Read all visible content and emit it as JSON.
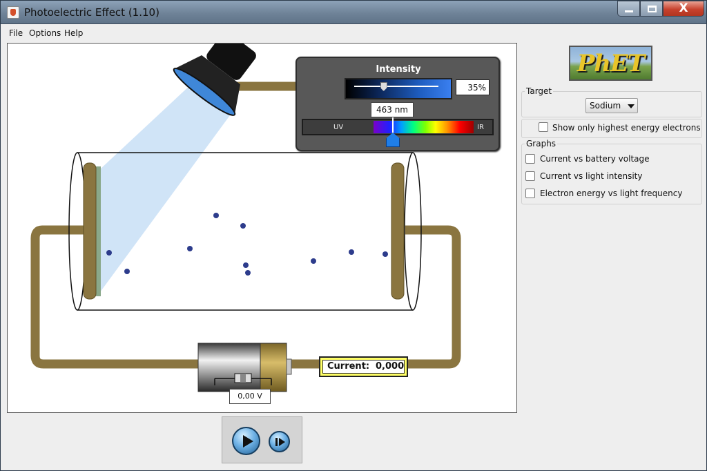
{
  "window": {
    "title": "Photoelectric Effect (1.10)",
    "close_glyph": "X"
  },
  "menu": {
    "items": [
      "File",
      "Options",
      "Help"
    ]
  },
  "intensity": {
    "label": "Intensity",
    "value_text": "35%",
    "value_fraction": 0.35
  },
  "wavelength": {
    "value_text": "463 nm",
    "uv_label": "UV",
    "ir_label": "IR"
  },
  "circuit": {
    "current_label": "Current:",
    "current_value": "0,000",
    "voltage_value": "0,00 V"
  },
  "right_panel": {
    "logo_text": "PhET",
    "target": {
      "label": "Target",
      "selected": "Sodium"
    },
    "highest_energy": {
      "label": "Show only highest energy electrons",
      "checked": false
    },
    "graphs": {
      "label": "Graphs",
      "items": [
        {
          "label": "Current vs battery voltage",
          "checked": false
        },
        {
          "label": "Current vs light intensity",
          "checked": false
        },
        {
          "label": "Electron energy vs light frequency",
          "checked": false
        }
      ]
    }
  },
  "icons": {
    "app": "java-icon",
    "play": "play-icon",
    "step": "step-forward-icon",
    "lamp": "flashlight-icon",
    "battery": "battery-icon"
  }
}
